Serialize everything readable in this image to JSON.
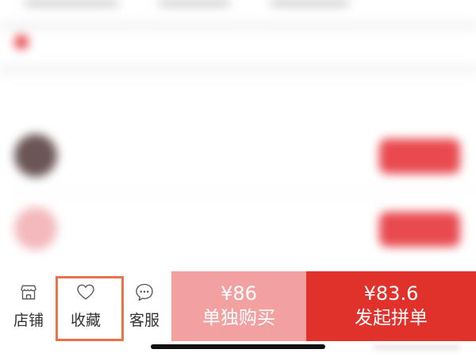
{
  "background_content": {
    "notice": "",
    "section_title": "",
    "groups": [
      {
        "user": "",
        "need": "",
        "time": "",
        "button": ""
      },
      {
        "user": "",
        "need": "",
        "time": "",
        "button": ""
      }
    ]
  },
  "bottom_bar": {
    "shop": {
      "label": "店铺",
      "icon": "store-icon"
    },
    "favorite": {
      "label": "收藏",
      "icon": "heart-icon"
    },
    "service": {
      "label": "客服",
      "icon": "chat-icon"
    },
    "single_buy": {
      "price": "¥86",
      "label": "单独购买"
    },
    "group_buy": {
      "price": "¥83.6",
      "label": "发起拼单"
    }
  },
  "colors": {
    "single_buy_bg": "#f3a0a1",
    "group_buy_bg": "#e0312b",
    "highlight": "#e8724a"
  }
}
